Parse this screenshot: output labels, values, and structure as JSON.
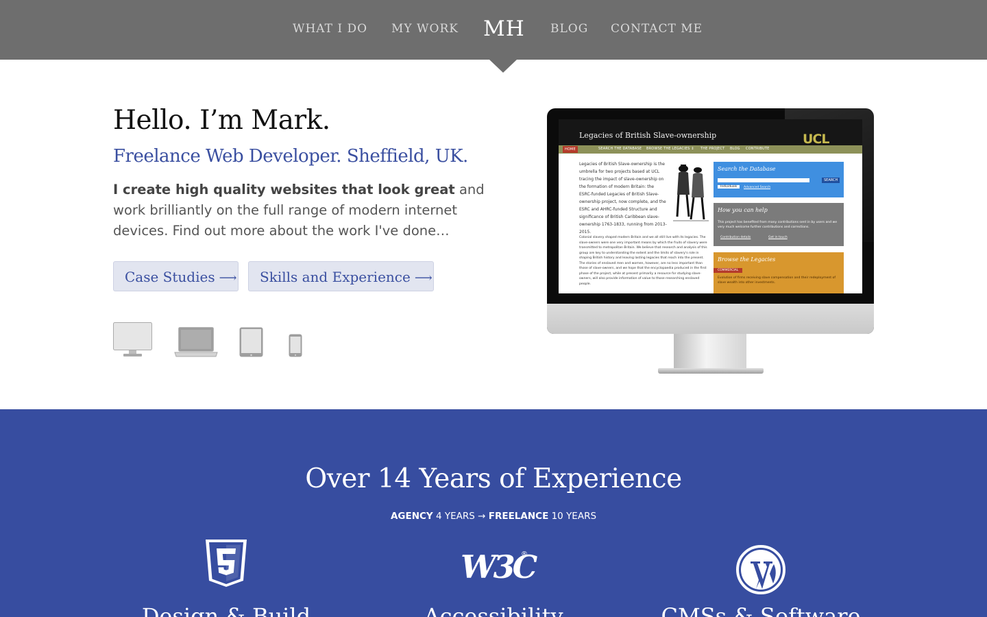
{
  "nav": {
    "items_left": [
      "WHAT I DO",
      "MY WORK"
    ],
    "logo": "MH",
    "items_right": [
      "BLOG",
      "CONTACT ME"
    ]
  },
  "hero": {
    "title": "Hello. I’m Mark.",
    "subtitle": "Freelance Web Developer. Sheffield, UK.",
    "intro_bold": "I create high quality websites that look great",
    "intro_rest": " and work brilliantly on the full range of modern internet devices. Find out more about the work I've done…",
    "buttons": [
      {
        "label": "Case Studies",
        "arrow": "⟶"
      },
      {
        "label": "Skills and Experience",
        "arrow": "⟶"
      }
    ],
    "device_icons": [
      "desktop-icon",
      "laptop-icon",
      "tablet-icon",
      "phone-icon"
    ]
  },
  "showcase": {
    "site_title": "Legacies of British Slave-ownership",
    "site_logo": "UCL",
    "site_nav": [
      "HOME",
      "SEARCH THE DATABASE",
      "BROWSE THE LEGACIES ↕",
      "THE PROJECT",
      "BLOG",
      "CONTRIBUTE"
    ],
    "intro_text": "Legacies of British Slave-ownership is the umbrella for two projects based at UCL tracing the impact of slave-ownership on the formation of modern Britain: the ESRC-funded Legacies of British Slave-ownership project, now complete, and the ESRC and AHRC-funded Structure and significance of British Caribbean slave-ownership 1763-1833, running from 2013-2015.",
    "body_text": "Colonial slavery shaped modern Britain and we all still live with its legacies. The slave-owners were one very important means by which the fruits of slavery were transmitted to metropolitan Britain. We believe that research and analysis of this group are key to understanding the extent and the limits of slavery's role in shaping British history and leaving lasting legacies that reach into the present. The stories of enslaved men and women, however, are no less important than those of slave-owners, and we hope that the encyclopaedia produced in the first phase of the project, while at present primarily a resource for studying slave-owners, will also provide information of value to those researching enslaved people.",
    "search_panel": {
      "title": "Search the Database",
      "select": "Individuals",
      "link": "Advanced Search",
      "button": "SEARCH"
    },
    "help_panel": {
      "title": "How you can help",
      "text": "This project has benefited from many contributions sent in by users and we very much welcome further contributions and corrections.",
      "link1": "Contribution details",
      "link2": "Get in touch"
    },
    "browse_panel": {
      "title": "Browse the Legacies",
      "tag": "COMMERCIAL",
      "text": "Evolution of firms receiving slave compensation and their redeployment of slave wealth into other investments."
    }
  },
  "experience": {
    "title": "Over 14 Years of Experience",
    "agency_label": "AGENCY",
    "agency_years": "4 YEARS",
    "arrow": "→",
    "freelance_label": "FREELANCE",
    "freelance_years": "10 YEARS",
    "features": [
      {
        "title": "Design & Build",
        "icon": "html5-icon"
      },
      {
        "title": "Accessibility",
        "icon": "w3c-icon"
      },
      {
        "title": "CMSs & Software",
        "icon": "wordpress-icon"
      }
    ],
    "w3c_mark": "W3C",
    "w3c_reg": "®"
  },
  "colors": {
    "nav_bg": "#6e6e6e",
    "accent": "#3a4fa0",
    "blue_section": "#374da0",
    "button_bg": "#e2e5f0"
  }
}
